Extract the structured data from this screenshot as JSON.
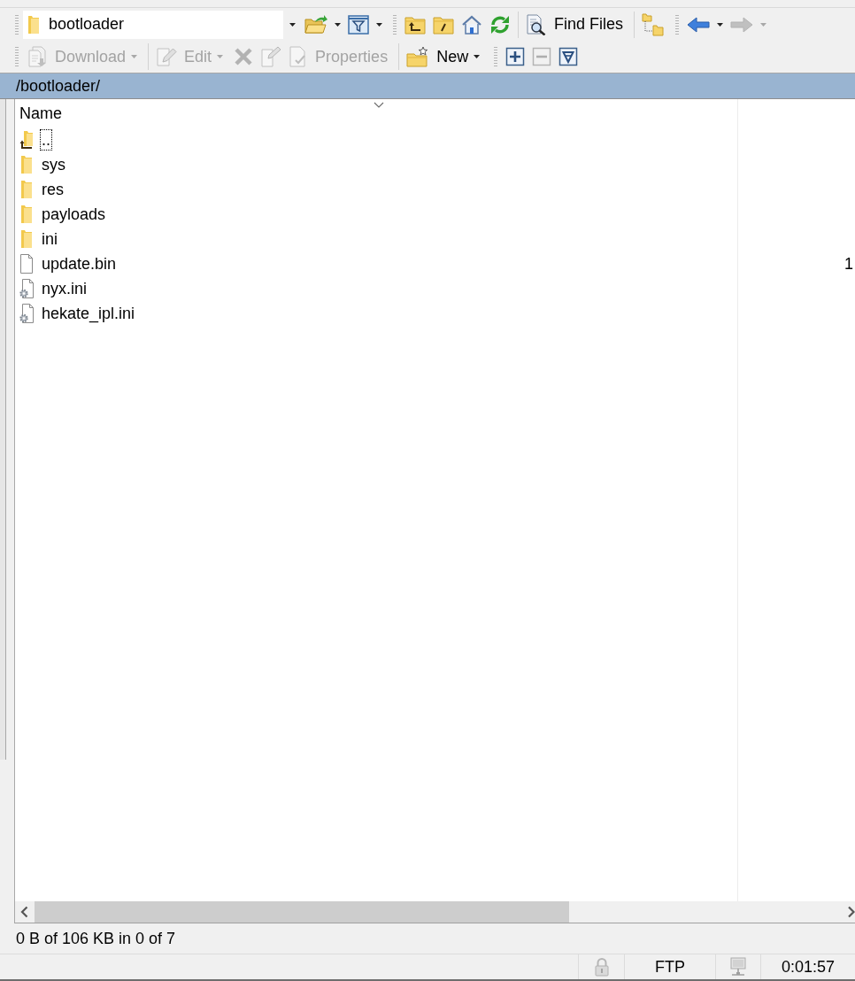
{
  "toolbars": [
    {
      "groups": [
        {
          "grip": true,
          "separator": false,
          "items": [
            {
              "kind": "location",
              "value": "bootloader",
              "dropdown": true,
              "disabled": false
            },
            {
              "kind": "open-directory",
              "dropdown": true,
              "disabled": false
            },
            {
              "kind": "filter",
              "dropdown": true,
              "disabled": false
            }
          ]
        },
        {
          "grip": true,
          "separator": false,
          "items": [
            {
              "kind": "parent-directory",
              "dropdown": false,
              "disabled": false
            },
            {
              "kind": "root-directory",
              "dropdown": false,
              "disabled": false
            },
            {
              "kind": "home-directory",
              "dropdown": false,
              "disabled": false
            },
            {
              "kind": "refresh",
              "dropdown": false,
              "disabled": false
            }
          ]
        },
        {
          "grip": false,
          "separator": true,
          "items": [
            {
              "kind": "find-files",
              "label": "Find Files",
              "dropdown": false,
              "disabled": false
            }
          ]
        },
        {
          "grip": false,
          "separator": true,
          "items": [
            {
              "kind": "tree",
              "dropdown": false,
              "disabled": false
            }
          ]
        },
        {
          "grip": true,
          "separator": false,
          "items": [
            {
              "kind": "back",
              "dropdown": true,
              "disabled": false
            },
            {
              "kind": "forward",
              "dropdown": true,
              "disabled": true
            }
          ]
        }
      ]
    },
    {
      "groups": [
        {
          "grip": true,
          "separator": false,
          "items": [
            {
              "kind": "download",
              "label": "Download",
              "dropdown": true,
              "disabled": true
            }
          ]
        },
        {
          "grip": false,
          "separator": true,
          "items": [
            {
              "kind": "edit",
              "label": "Edit",
              "dropdown": true,
              "disabled": true
            },
            {
              "kind": "delete",
              "dropdown": false,
              "disabled": true
            },
            {
              "kind": "rename",
              "dropdown": false,
              "disabled": true
            },
            {
              "kind": "properties",
              "label": "Properties",
              "dropdown": false,
              "disabled": true
            }
          ]
        },
        {
          "grip": false,
          "separator": true,
          "items": [
            {
              "kind": "new",
              "label": "New",
              "dropdown": true,
              "disabled": false
            }
          ]
        },
        {
          "grip": true,
          "separator": false,
          "items": [
            {
              "kind": "select",
              "dropdown": false,
              "disabled": false
            },
            {
              "kind": "unselect",
              "dropdown": false,
              "disabled": true
            },
            {
              "kind": "filter-select",
              "dropdown": false,
              "disabled": false
            }
          ]
        }
      ]
    }
  ],
  "path_bar": {
    "path": "/bootloader/"
  },
  "file_list": {
    "columns": [
      {
        "label": "Name",
        "sort_descending": true
      }
    ],
    "rows": [
      {
        "name": "..",
        "kind": "parent",
        "focused": true,
        "selected": false
      },
      {
        "name": "sys",
        "kind": "folder",
        "focused": false,
        "selected": false
      },
      {
        "name": "res",
        "kind": "folder",
        "focused": false,
        "selected": false
      },
      {
        "name": "payloads",
        "kind": "folder",
        "focused": false,
        "selected": false
      },
      {
        "name": "ini",
        "kind": "folder",
        "focused": false,
        "selected": false
      },
      {
        "name": "update.bin",
        "kind": "file",
        "column_2": "1",
        "focused": false,
        "selected": false
      },
      {
        "name": "nyx.ini",
        "kind": "settings-file",
        "focused": false,
        "selected": false
      },
      {
        "name": "hekate_ipl.ini",
        "kind": "settings-file",
        "focused": false,
        "selected": false
      }
    ]
  },
  "status_bar": {
    "summary": "0 B of 106 KB in 0 of 7",
    "panels": [
      {
        "kind": "lock"
      },
      {
        "kind": "text",
        "text": "FTP"
      },
      {
        "kind": "network"
      },
      {
        "kind": "text",
        "text": "0:01:57"
      }
    ]
  }
}
